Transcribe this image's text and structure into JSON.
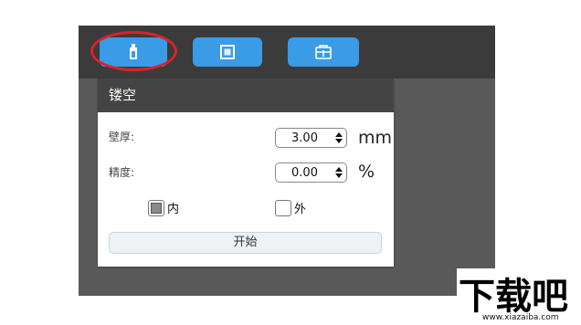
{
  "toolbar": {
    "buttons": [
      {
        "name": "hollow-tool",
        "icon": "bottle-icon",
        "active": true
      },
      {
        "name": "shell-tool",
        "icon": "square-frame-icon"
      },
      {
        "name": "support-tool",
        "icon": "box-plus-icon"
      }
    ],
    "accent": "#3a9be6",
    "highlight_color": "#d9232b"
  },
  "panel": {
    "title": "镂空",
    "wall_thickness": {
      "label": "壁厚:",
      "value": "3.00",
      "unit": "mm"
    },
    "precision": {
      "label": "精度:",
      "value": "0.00",
      "unit": "%"
    },
    "inside": {
      "label": "内",
      "checked": true
    },
    "outside": {
      "label": "外",
      "checked": false
    },
    "start_label": "开始"
  },
  "watermark": {
    "main": "下载吧",
    "url": "www.xiazaiba.com"
  }
}
